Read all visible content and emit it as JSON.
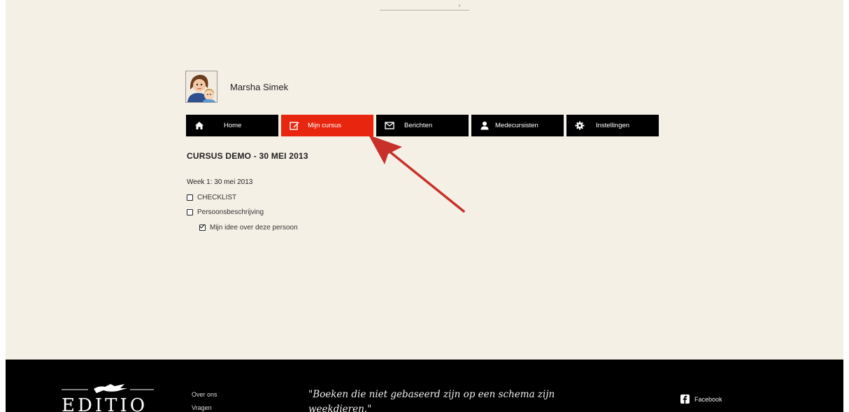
{
  "user": {
    "name": "Marsha Simek"
  },
  "nav": {
    "items": [
      {
        "label": "Home",
        "icon": "home-icon",
        "active": false
      },
      {
        "label": "Mijn cursus",
        "icon": "edit-icon",
        "active": true
      },
      {
        "label": "Berichten",
        "icon": "envelope-icon",
        "active": false
      },
      {
        "label": "Medecursisten",
        "icon": "user-icon",
        "active": false
      },
      {
        "label": "Instellingen",
        "icon": "gear-icon",
        "active": false
      }
    ]
  },
  "course": {
    "title": "CURSUS DEMO - 30 MEI 2013",
    "week": "Week 1: 30 mei 2013",
    "lessons": [
      {
        "label": "CHECKLIST",
        "checked": false
      },
      {
        "label": "Persoonsbeschrijving",
        "checked": false
      },
      {
        "label": "Mijn idee over deze persoon",
        "checked": true
      }
    ]
  },
  "footer": {
    "logo_text": "EDITIO",
    "links": [
      "Over ons",
      "Vragen"
    ],
    "quote": "\"Boeken die niet gebaseerd zijn op een schema zijn weekdieren.\"",
    "facebook_label": "Facebook"
  },
  "colors": {
    "page_background": "#f5f0e6",
    "nav_background": "#000000",
    "nav_active": "#e8260f",
    "annotation_arrow": "#c8302b",
    "footer_background": "#000000"
  }
}
